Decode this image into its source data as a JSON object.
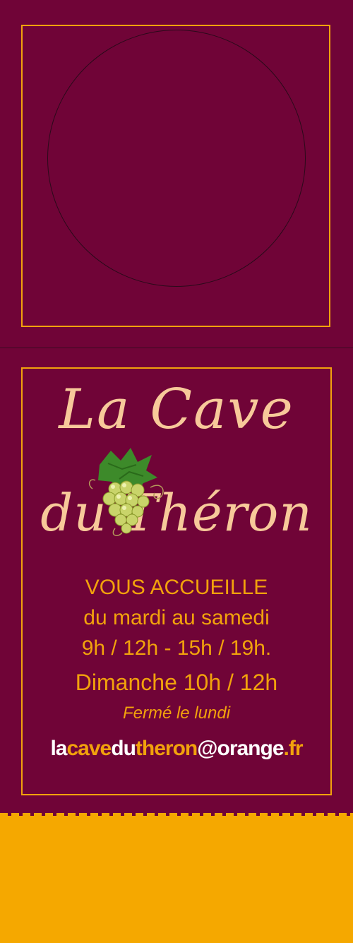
{
  "logo": {
    "line1": "La Cave",
    "line2": "du Théron",
    "icon": "grape-vine-icon"
  },
  "info": {
    "welcome": "VOUS ACCUEILLE",
    "days": "du mardi au samedi",
    "hours": "9h / 12h - 15h / 19h.",
    "sunday": "Dimanche 10h / 12h",
    "closed": "Fermé le lundi"
  },
  "email": {
    "p1": "la",
    "p2": "cave",
    "p3": "du",
    "p4": "theron",
    "p5": "@orange",
    "p6": ".fr"
  },
  "colors": {
    "background": "#700437",
    "accent": "#f2a20c",
    "logo_text": "#f7c99a",
    "bottom_band": "#f5a800"
  }
}
